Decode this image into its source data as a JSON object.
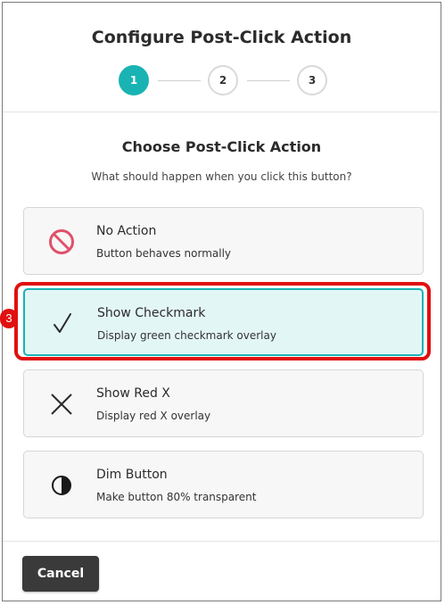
{
  "dialog": {
    "title": "Configure Post-Click Action"
  },
  "stepper": {
    "steps": [
      {
        "label": "1",
        "state": "active"
      },
      {
        "label": "2",
        "state": "inactive"
      },
      {
        "label": "3",
        "state": "inactive"
      }
    ]
  },
  "content": {
    "section_title": "Choose Post-Click Action",
    "section_subtitle": "What should happen when you click this button?"
  },
  "options": [
    {
      "title": "No Action",
      "description": "Button behaves normally",
      "icon": "prohibited-icon",
      "selected": false
    },
    {
      "title": "Show Checkmark",
      "description": "Display green checkmark overlay",
      "icon": "checkmark-icon",
      "selected": true
    },
    {
      "title": "Show Red X",
      "description": "Display red X overlay",
      "icon": "x-icon",
      "selected": false
    },
    {
      "title": "Dim Button",
      "description": "Make button 80% transparent",
      "icon": "half-circle-icon",
      "selected": false
    }
  ],
  "annotation": {
    "badge": "3"
  },
  "footer": {
    "cancel_label": "Cancel"
  },
  "colors": {
    "accent": "#1ab3b3",
    "selected_bg": "#e3f6f6",
    "highlight": "#e01010",
    "prohibited": "#e0506a",
    "button_dark": "#3a3a3a"
  }
}
